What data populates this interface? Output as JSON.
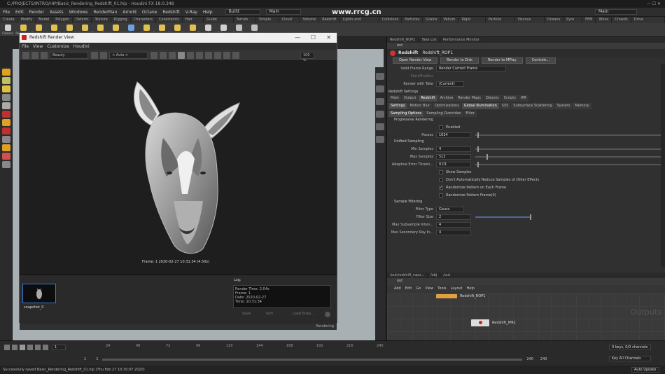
{
  "window": {
    "title": "C:/PROJECTS/INTRO/HIP/Basic_Rendering_Redshift_01.hip - Houdini FX 18.0.348"
  },
  "menubar": {
    "items": [
      "File",
      "Edit",
      "Render",
      "Assets",
      "Windows",
      "RenderMan",
      "Arnold",
      "Octane",
      "Redshift",
      "V-Ray",
      "Help"
    ],
    "desktop": "Build",
    "context": "Main"
  },
  "shelf": {
    "tabs": [
      "Create",
      "Modify",
      "Model",
      "Polygon",
      "Deform",
      "Texture",
      "Rigging",
      "Characters",
      "Constraints",
      "Hair Utils",
      "Guide Process",
      "Terrain FX",
      "Simple FX",
      "Cloud FX",
      "Volume",
      "Redshift",
      "Lights and Cameras",
      "Collisions",
      "Particles",
      "Grains",
      "Vellum",
      "Rigid Bodies",
      "Particle Fluids",
      "Viscous Fluids",
      "Oceans",
      "Pyro FX",
      "FEM",
      "Wires",
      "Crowds",
      "Drive Simulation"
    ],
    "tools": [
      {
        "label": "Camera",
        "color": "#d0d0d0"
      },
      {
        "label": "Point Light",
        "color": "#e0c050"
      },
      {
        "label": "Spot Light",
        "color": "#e0c050"
      },
      {
        "label": "Area Light",
        "color": "#e0c050"
      },
      {
        "label": "Geometry Light",
        "color": "#e0c050"
      },
      {
        "label": "Volume Light",
        "color": "#e0c050"
      },
      {
        "label": "Distant Light",
        "color": "#e0c050"
      },
      {
        "label": "Environment Light",
        "color": "#e0c050"
      },
      {
        "label": "Sky",
        "color": "#70a0e0"
      },
      {
        "label": "GI Light",
        "color": "#e0c050"
      },
      {
        "label": "Caustic Light",
        "color": "#e0c050"
      },
      {
        "label": "Portal Light",
        "color": "#e0c050"
      },
      {
        "label": "Ambient Light",
        "color": "#e0c050"
      },
      {
        "label": "Stereo Camera",
        "color": "#d0d0d0"
      },
      {
        "label": "VR Camera",
        "color": "#d0d0d0"
      },
      {
        "label": "Switcher",
        "color": "#c0c0c0"
      },
      {
        "label": "Gamepad Camera",
        "color": "#c0c0c0"
      }
    ]
  },
  "redshift_render_view": {
    "title": "Redshift Render View",
    "menu": [
      "File",
      "View",
      "Customize",
      "Houdini"
    ],
    "toolbar": {
      "display_mode": "Beauty",
      "aov": "< Auto >",
      "zoom": "100 %"
    },
    "frame_info": "Frame: 1   2020-02-27  10:31:34  (4.50s)",
    "snapshot_label": "snapshot_0",
    "log_label": "Log:",
    "log_lines": [
      "Render Time: 2.04s",
      "Frame: 1",
      "Date: 2020-02-27",
      "Time: 10:31:34"
    ],
    "log_buttons": [
      "Save",
      "Sort",
      "Load Snap..."
    ],
    "status": "Rendering"
  },
  "parameter_panel": {
    "tabs": [
      "Redshift_ROP1",
      "Take List",
      "Performance Monitor"
    ],
    "path": "out",
    "node_type": "Redshift",
    "node_name": "Redshift_ROP1",
    "actions": [
      "Render to MPlay",
      "Open Render View",
      "Render to Disk",
      "Render to MPlay",
      "Controls..."
    ],
    "valid_frame_range_label": "Valid Frame Range",
    "valid_frame_range_value": "Render Current Frame",
    "start_end_label": "Start/End/Inc",
    "render_with_take_label": "Render with Take",
    "render_with_take_value": "(Current)",
    "settings_title": "Redshift Settings",
    "main_tabs": [
      "Main",
      "Output",
      "Redshift",
      "Archive",
      "Render Maps",
      "Objects",
      "Scripts",
      "IPR"
    ],
    "sub_tabs": [
      "Settings",
      "Motion Blur",
      "Optimizations",
      "Global Illumination",
      "SSS",
      "Subsurface Scattering",
      "System",
      "Memory"
    ],
    "sampling_tabs": [
      "Sampling Options",
      "Sampling Overrides",
      "Filter"
    ],
    "progressive_title": "Progressive Rendering",
    "enabled_label": "Enabled",
    "passes_label": "Passes",
    "passes_value": "1024",
    "unified_title": "Unified Sampling",
    "min_samples_label": "Min Samples",
    "min_samples_value": "4",
    "max_samples_label": "Max Samples",
    "max_samples_value": "512",
    "adaptive_label": "Adaptive Error Thresh...",
    "adaptive_value": "0.01",
    "checks": [
      {
        "label": "Show Samples",
        "checked": false
      },
      {
        "label": "Don't Automatically Reduce Samples of Other Effects",
        "checked": false
      },
      {
        "label": "Randomize Pattern on Each Frame",
        "checked": true
      },
      {
        "label": "Randomize Pattern Frame(0)",
        "checked": false
      }
    ],
    "sample_filter_title": "Sample Filtering",
    "filter_type_label": "Filter Type",
    "filter_type_value": "Gauss",
    "filter_size_label": "Filter Size",
    "filter_size_value": "2",
    "max_sub_label": "Max Subsample Inten...",
    "max_sub_value": "4",
    "max_sec_label": "Max Secondary Ray In...",
    "max_sec_value": "4"
  },
  "network": {
    "tabs": [
      "/out/redshift_ropo...",
      "/obj",
      "/out"
    ],
    "path": "out",
    "menu": [
      "Add",
      "Edit",
      "Go",
      "View",
      "Tools",
      "Layout",
      "Help"
    ],
    "node1": "Redshift_ROP1",
    "node2": "Redshift_IPR1",
    "watermark": "Outputs"
  },
  "timeline": {
    "frame": "1",
    "ticks": [
      "24",
      "48",
      "72",
      "96",
      "120",
      "144",
      "168",
      "192",
      "216",
      "240"
    ],
    "start": "1",
    "start2": "1",
    "end": "240",
    "end2": "240",
    "keys_label": "0 keys, 0/0 channels",
    "key_all": "Key All Channels",
    "auto_update": "Auto Update"
  },
  "statusbar": {
    "text": "Successfully saved Basic_Rendering_Redshift_01.hip (Thu Feb 27 10:30:07 2020)"
  },
  "watermark": {
    "site": "www.rrcg.cn"
  }
}
